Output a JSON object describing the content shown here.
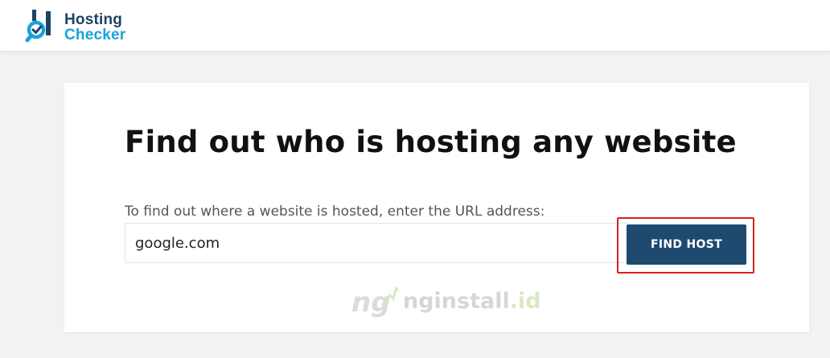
{
  "header": {
    "logo": {
      "line1": "Hosting",
      "line2": "Checker"
    }
  },
  "main": {
    "title": "Find out who is hosting any website",
    "instruction": "To find out where a website is hosted, enter the URL address:",
    "url_input": {
      "value": "google.com",
      "placeholder": ""
    },
    "find_button_label": "FIND HOST"
  },
  "watermark": {
    "name": "nginstall",
    "dot": ".",
    "tld": "id"
  },
  "colors": {
    "brand_dark": "#1d4465",
    "brand_light": "#1aa3d9",
    "button_bg": "#1e4a70",
    "highlight_border": "#d6201f"
  },
  "icons": {
    "logo": "hosting-checker-logo-icon",
    "watermark": "nginstall-logo-icon"
  }
}
